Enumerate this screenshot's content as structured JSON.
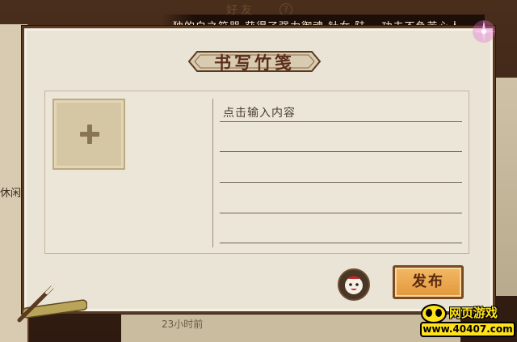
{
  "background": {
    "panel_title": "好友",
    "help_label": "?",
    "left_label": "休闲",
    "time_text": "23小时前"
  },
  "broadcast": {
    "text": "独的白之符咒 获得了强力御魂 针女·陆， 功夫不负苦心人"
  },
  "dialog": {
    "title": "书写竹笺",
    "text_placeholder": "点击输入内容",
    "publish_label": "发布"
  },
  "watermark": {
    "line1": "网页游戏",
    "line2": "www.40407.com"
  },
  "colors": {
    "dialog_bg": "#eae4d6",
    "frame_brown": "#5a3a22",
    "button_orange": "#e9a24a",
    "title_red_brown": "#5a2e1a",
    "watermark_yellow": "#ffe21a"
  },
  "icons": [
    "plus-icon",
    "avatar-face-icon",
    "sparkle-icon",
    "bamboo-brush-icon",
    "help-icon"
  ]
}
